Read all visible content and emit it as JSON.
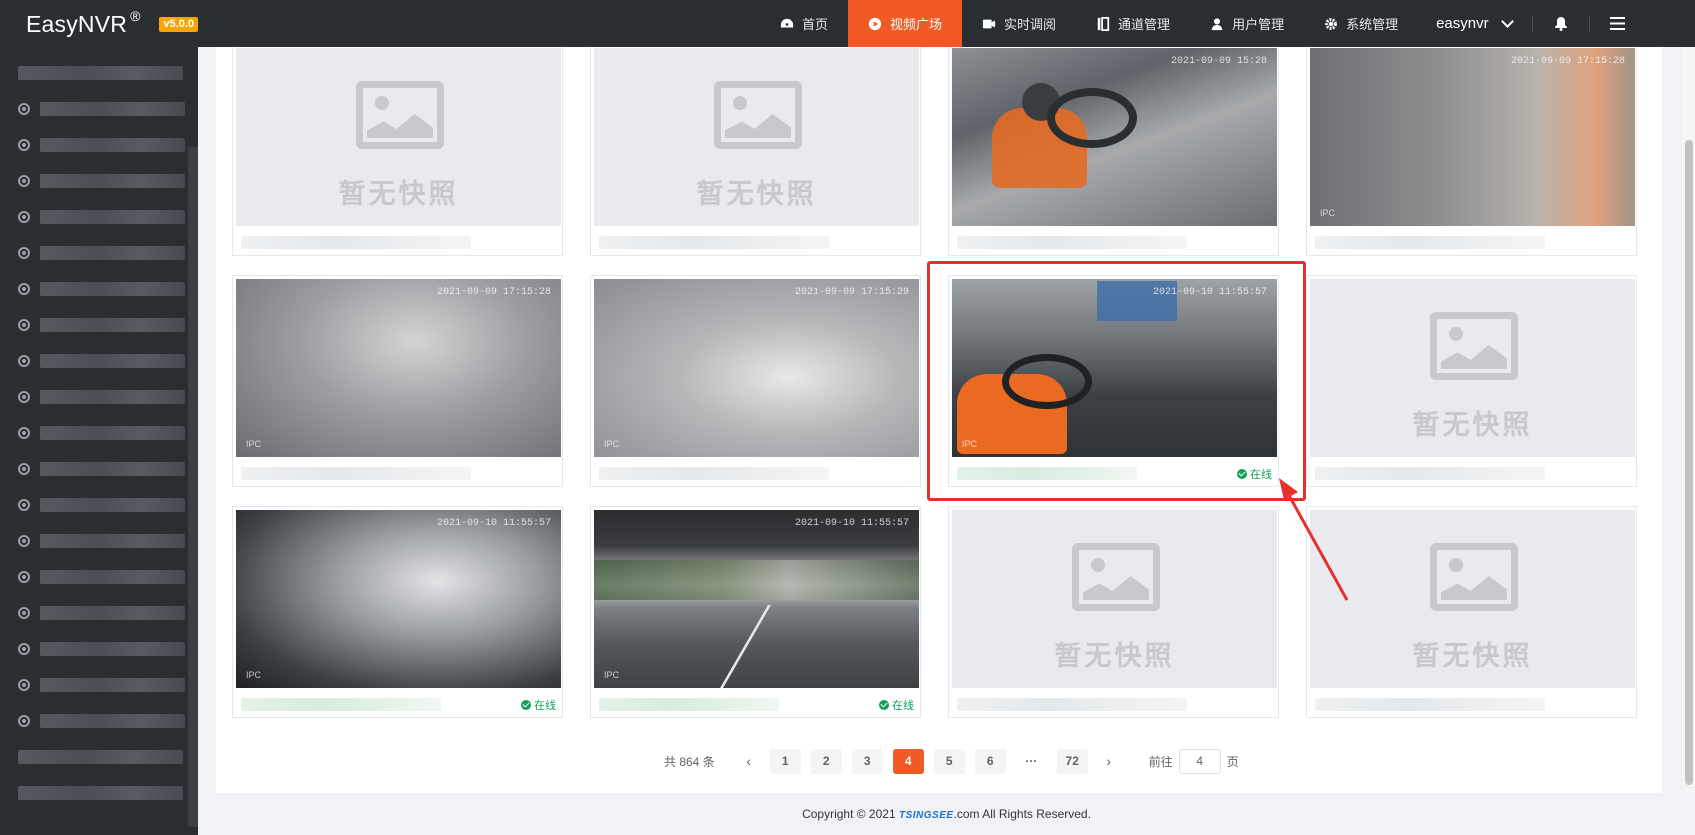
{
  "app": {
    "name": "EasyNVR",
    "registered_mark": "®",
    "version": "v5.0.0"
  },
  "nav": {
    "items": [
      {
        "label": "首页",
        "icon": "dashboard-icon",
        "active": false
      },
      {
        "label": "视频广场",
        "icon": "play-circle-icon",
        "active": true
      },
      {
        "label": "实时调阅",
        "icon": "video-camera-icon",
        "active": false
      },
      {
        "label": "通道管理",
        "icon": "channel-list-icon",
        "active": false
      },
      {
        "label": "用户管理",
        "icon": "user-icon",
        "active": false
      },
      {
        "label": "系统管理",
        "icon": "gear-icon",
        "active": false
      }
    ],
    "user": "easynvr"
  },
  "cards": [
    {
      "has_snapshot": false,
      "placeholder": "暂无快照",
      "status": ""
    },
    {
      "has_snapshot": false,
      "placeholder": "暂无快照",
      "status": ""
    },
    {
      "has_snapshot": true,
      "timestamp": "2021-09-09 15:28",
      "status": ""
    },
    {
      "has_snapshot": true,
      "timestamp": "2021-09-09 17:15:28",
      "ipc": "IPC",
      "status": ""
    },
    {
      "has_snapshot": true,
      "timestamp": "2021-09-09 17:15:28",
      "ipc": "IPC",
      "status": ""
    },
    {
      "has_snapshot": true,
      "timestamp": "2021-09-09 17:15:29",
      "ipc": "IPC",
      "status": ""
    },
    {
      "has_snapshot": true,
      "timestamp": "2021-09-10 11:55:57",
      "ipc": "IPC",
      "status": "在线"
    },
    {
      "has_snapshot": false,
      "placeholder": "暂无快照",
      "status": ""
    },
    {
      "has_snapshot": true,
      "timestamp": "2021-09-10 11:55:57",
      "ipc": "IPC",
      "status": "在线"
    },
    {
      "has_snapshot": true,
      "timestamp": "2021-09-10 11:55:57",
      "ipc": "IPC",
      "status": "在线"
    },
    {
      "has_snapshot": false,
      "placeholder": "暂无快照",
      "status": ""
    },
    {
      "has_snapshot": false,
      "placeholder": "暂无快照",
      "status": ""
    }
  ],
  "pagination": {
    "total_label": "共 864 条",
    "pages": [
      "1",
      "2",
      "3",
      "4",
      "5",
      "6"
    ],
    "current": "4",
    "more": "···",
    "last": "72",
    "goto_prefix": "前往",
    "goto_value": "4",
    "goto_suffix": "页"
  },
  "footer": {
    "prefix": "Copyright © 2021",
    "brand": "TSINGSEE",
    "suffix": ".com All Rights Reserved."
  },
  "colors": {
    "accent": "#f25a25",
    "online": "#13a05a",
    "highlight": "#e8302a",
    "topbar": "#2a2e33"
  }
}
